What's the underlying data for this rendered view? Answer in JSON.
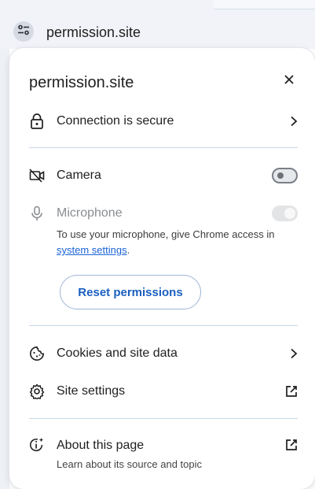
{
  "omnibox": {
    "url": "permission.site",
    "site_icon": "tune-icon"
  },
  "panel": {
    "title": "permission.site",
    "close_icon": "close-icon",
    "connection": {
      "label": "Connection is secure",
      "icon": "lock-icon",
      "trailing": "chevron-right-icon"
    },
    "permissions": [
      {
        "label": "Camera",
        "icon": "camera-off-icon",
        "state": "off"
      },
      {
        "label": "Microphone",
        "icon": "microphone-icon",
        "state": "disabled",
        "desc_before": "To use your microphone, give Chrome access in ",
        "desc_link": "system settings",
        "desc_after": "."
      }
    ],
    "reset_label": "Reset permissions",
    "links": [
      {
        "label": "Cookies and site data",
        "icon": "cookie-icon",
        "trailing": "chevron-right-icon"
      },
      {
        "label": "Site settings",
        "icon": "gear-icon",
        "trailing": "open-in-new-icon"
      }
    ],
    "about": {
      "label": "About this page",
      "sub": "Learn about its source and topic",
      "icon": "info-sparkle-icon",
      "trailing": "open-in-new-icon"
    }
  },
  "colors": {
    "accent": "#1b5fbf",
    "link": "#1a63d4",
    "divider": "#c7d7e8"
  }
}
